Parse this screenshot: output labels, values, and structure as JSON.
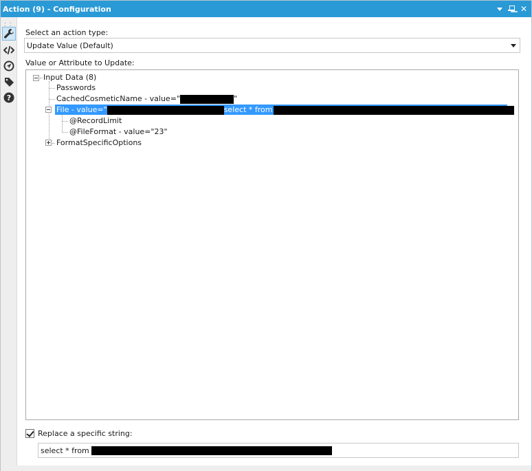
{
  "window": {
    "title": "Action (9) - Configuration"
  },
  "sidebar": {
    "icons": [
      "wrench-icon",
      "code-icon",
      "navigation-icon",
      "tag-icon",
      "help-icon"
    ]
  },
  "action_type": {
    "label": "Select an action type:",
    "selected": "Update Value (Default)"
  },
  "tree": {
    "label": "Value or Attribute to Update:",
    "root": "Input Data (8)",
    "items": {
      "passwords": "Passwords",
      "cached": "CachedCosmeticName - value=\"",
      "cached_end": "\"",
      "file_prefix": "File - value=\"",
      "file_mid": "select * from",
      "file_end": "\"",
      "record_limit": "@RecordLimit",
      "file_format": "@FileFormat - value=\"23\"",
      "format_options": "FormatSpecificOptions"
    }
  },
  "replace": {
    "label": "Replace a specific string:",
    "checked": true,
    "value_prefix": "select * from"
  },
  "colors": {
    "titlebar": "#2a9ad6",
    "selection": "#3399ff"
  }
}
